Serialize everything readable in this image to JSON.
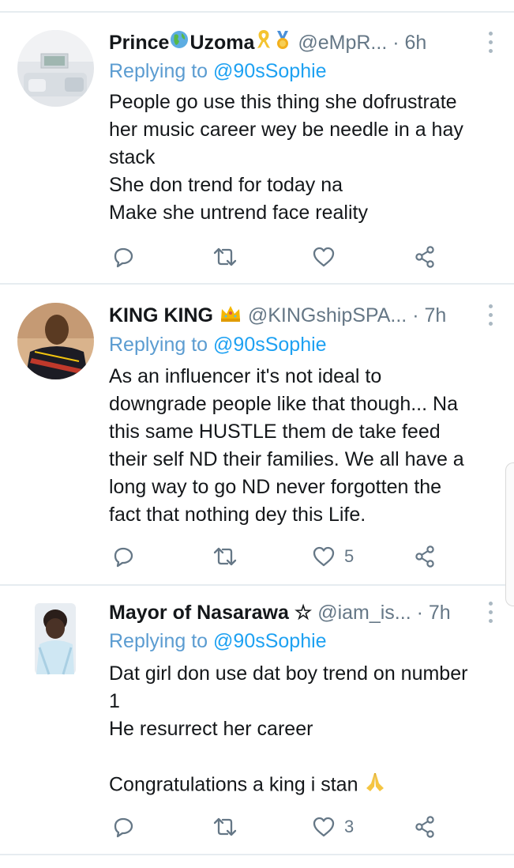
{
  "tweets": [
    {
      "name": "Prince",
      "name2": "Uzoma",
      "handle": "@eMpR...",
      "time": "· 6h",
      "replying_prefix": "Replying to",
      "replying_to": "@90sSophie",
      "text": "People go use this thing she dofrustrate\nher music career wey be needle in a hay\nstack\nShe don trend for today na\nMake she untrend face reality",
      "likes": ""
    },
    {
      "name": "KING KING",
      "handle": "@KINGshipSPA...",
      "time": "· 7h",
      "replying_prefix": "Replying to",
      "replying_to": "@90sSophie",
      "text": "As an influencer it's not ideal to\ndowngrade people like that though... Na\nthis same HUSTLE them de take feed\ntheir self ND their families. We all have a\nlong way to go ND never forgotten the\nfact that nothing dey this Life.",
      "likes": "5"
    },
    {
      "name": "Mayor of Nasarawa ☆",
      "handle": "@iam_is...",
      "time": "· 7h",
      "replying_prefix": "Replying to",
      "replying_to": "@90sSophie",
      "text": "Dat girl don use dat boy trend on number\n1\nHe resurrect her career\n\nCongratulations a king i stan",
      "likes": "3"
    }
  ],
  "icons": {
    "reply": "reply-icon",
    "retweet": "retweet-icon",
    "like": "heart-icon",
    "share": "share-icon",
    "more": "more-vertical-icon"
  },
  "colors": {
    "link": "#1da1f2",
    "secondary": "#657786",
    "icon": "#657786",
    "divider": "#e6ecf0"
  }
}
